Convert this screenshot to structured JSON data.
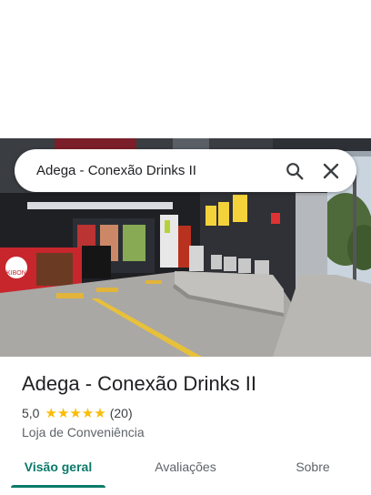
{
  "search": {
    "query": "Adega - Conexão Drinks II",
    "search_icon": "search-icon",
    "close_icon": "close-icon"
  },
  "place": {
    "photo": "storefront-street-view-photo",
    "name": "Adega - Conexão Drinks II",
    "rating": "5,0",
    "stars": 5,
    "stars_text": "★★★★★",
    "review_count": "(20)",
    "category": "Loja de Conveniência",
    "sign_text": "KIBON"
  },
  "tabs": [
    {
      "label": "Visão geral",
      "active": true
    },
    {
      "label": "Avaliações",
      "active": false
    },
    {
      "label": "Sobre",
      "active": false
    }
  ],
  "colors": {
    "accent": "#0b7a6a",
    "star": "#fbbc04"
  }
}
